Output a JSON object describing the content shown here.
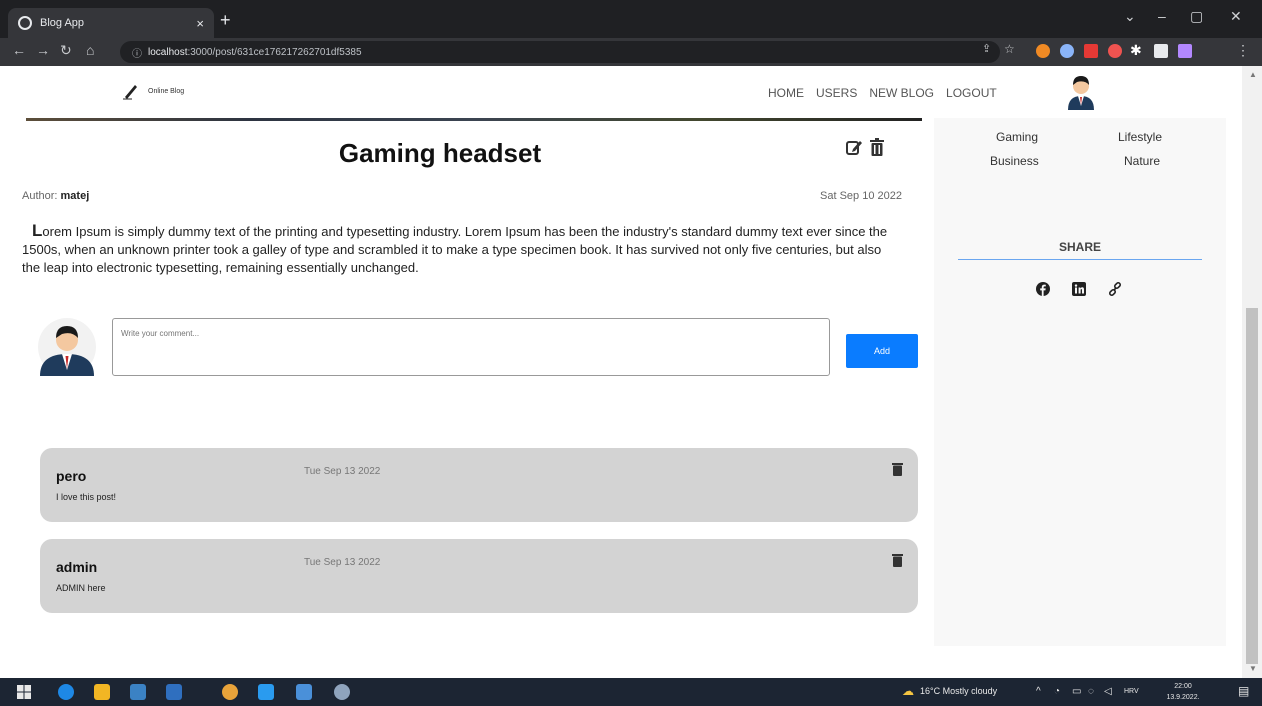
{
  "browser": {
    "tab_title": "Blog App",
    "tab_close": "×",
    "new_tab": "+",
    "url_host": "localhost",
    "url_rest": ":3000/post/631ce176217262701df5385",
    "window_controls": [
      "⌄",
      "–",
      "▢",
      "✕"
    ]
  },
  "navbar": {
    "logo_text": "Online Blog",
    "links": [
      "HOME",
      "USERS",
      "NEW BLOG",
      "LOGOUT"
    ]
  },
  "post": {
    "title": "Gaming headset",
    "author_label": "Author: ",
    "author_name": "matej",
    "date": "Sat Sep 10 2022",
    "drop_cap": "L",
    "body": "orem Ipsum is simply dummy text of the printing and typesetting industry. Lorem Ipsum has been the industry's standard dummy text ever since the 1500s, when an unknown printer took a galley of type and scrambled it to make a type specimen book. It has survived not only five centuries, but also the leap into electronic typesetting, remaining essentially unchanged."
  },
  "comment_form": {
    "placeholder": "Write your comment...",
    "add_label": "Add"
  },
  "comments": [
    {
      "author": "pero",
      "date": "Tue Sep 13 2022",
      "text": "I love this post!"
    },
    {
      "author": "admin",
      "date": "Tue Sep 13 2022",
      "text": "ADMIN here"
    }
  ],
  "sidebar": {
    "categories": [
      "Gaming",
      "Lifestyle",
      "Business",
      "Nature"
    ],
    "share_title": "SHARE",
    "share_icons": [
      "facebook-icon",
      "linkedin-icon",
      "link-icon"
    ]
  },
  "taskbar": {
    "weather": "16°C  Mostly cloudy",
    "lang": "HRV",
    "time": "22:00",
    "date": "13.9.2022."
  },
  "colors": {
    "accent": "#0a7cff",
    "comment_bg": "#d3d3d3",
    "share_line": "#6aa6f0"
  }
}
